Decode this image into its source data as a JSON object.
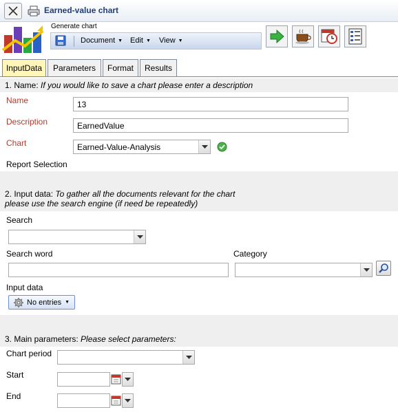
{
  "window": {
    "title": "Earned-value chart"
  },
  "header": {
    "generate_label": "Generate chart",
    "menus": {
      "document": "Document",
      "edit": "Edit",
      "view": "View"
    }
  },
  "tabs": [
    {
      "label": "InputData",
      "active": true
    },
    {
      "label": "Parameters",
      "active": false
    },
    {
      "label": "Format",
      "active": false
    },
    {
      "label": "Results",
      "active": false
    }
  ],
  "section1": {
    "heading_prefix": "1. Name: ",
    "heading_hint": "If you would like to save a chart please enter a description",
    "name_label": "Name",
    "name_value": "13",
    "description_label": "Description",
    "description_value": "EarnedValue",
    "chart_label": "Chart",
    "chart_value": "Earned-Value-Analysis",
    "report_selection_label": "Report Selection"
  },
  "section2": {
    "heading_prefix": "2. Input data: ",
    "heading_hint_line1": "To gather all the documents relevant for the chart",
    "heading_hint_line2": "please use the search engine (if need be repeatedly)",
    "search_label": "Search",
    "search_value": "",
    "search_word_label": "Search word",
    "search_word_value": "",
    "category_label": "Category",
    "category_value": "",
    "input_data_label": "Input data",
    "entries_button": "No entries"
  },
  "section3": {
    "heading_prefix": "3. Main parameters: ",
    "heading_hint": "Please select parameters:",
    "chart_period_label": "Chart period",
    "chart_period_value": "",
    "start_label": "Start",
    "start_value": "",
    "end_label": "End",
    "end_value": ""
  },
  "colors": {
    "title_text": "#1f3f7a",
    "required_label": "#b13a2e",
    "active_tab": "#fff6b8",
    "section_band": "#efefef"
  },
  "icons": {
    "close": "close-icon",
    "print": "print-icon",
    "save": "save-icon",
    "run": "green-arrow-icon",
    "break": "coffee-cup-icon",
    "schedule": "calendar-clock-icon",
    "report": "report-list-icon",
    "valid": "check-icon",
    "search": "magnifier-icon",
    "gear": "gear-icon",
    "calendar": "calendar-icon"
  }
}
